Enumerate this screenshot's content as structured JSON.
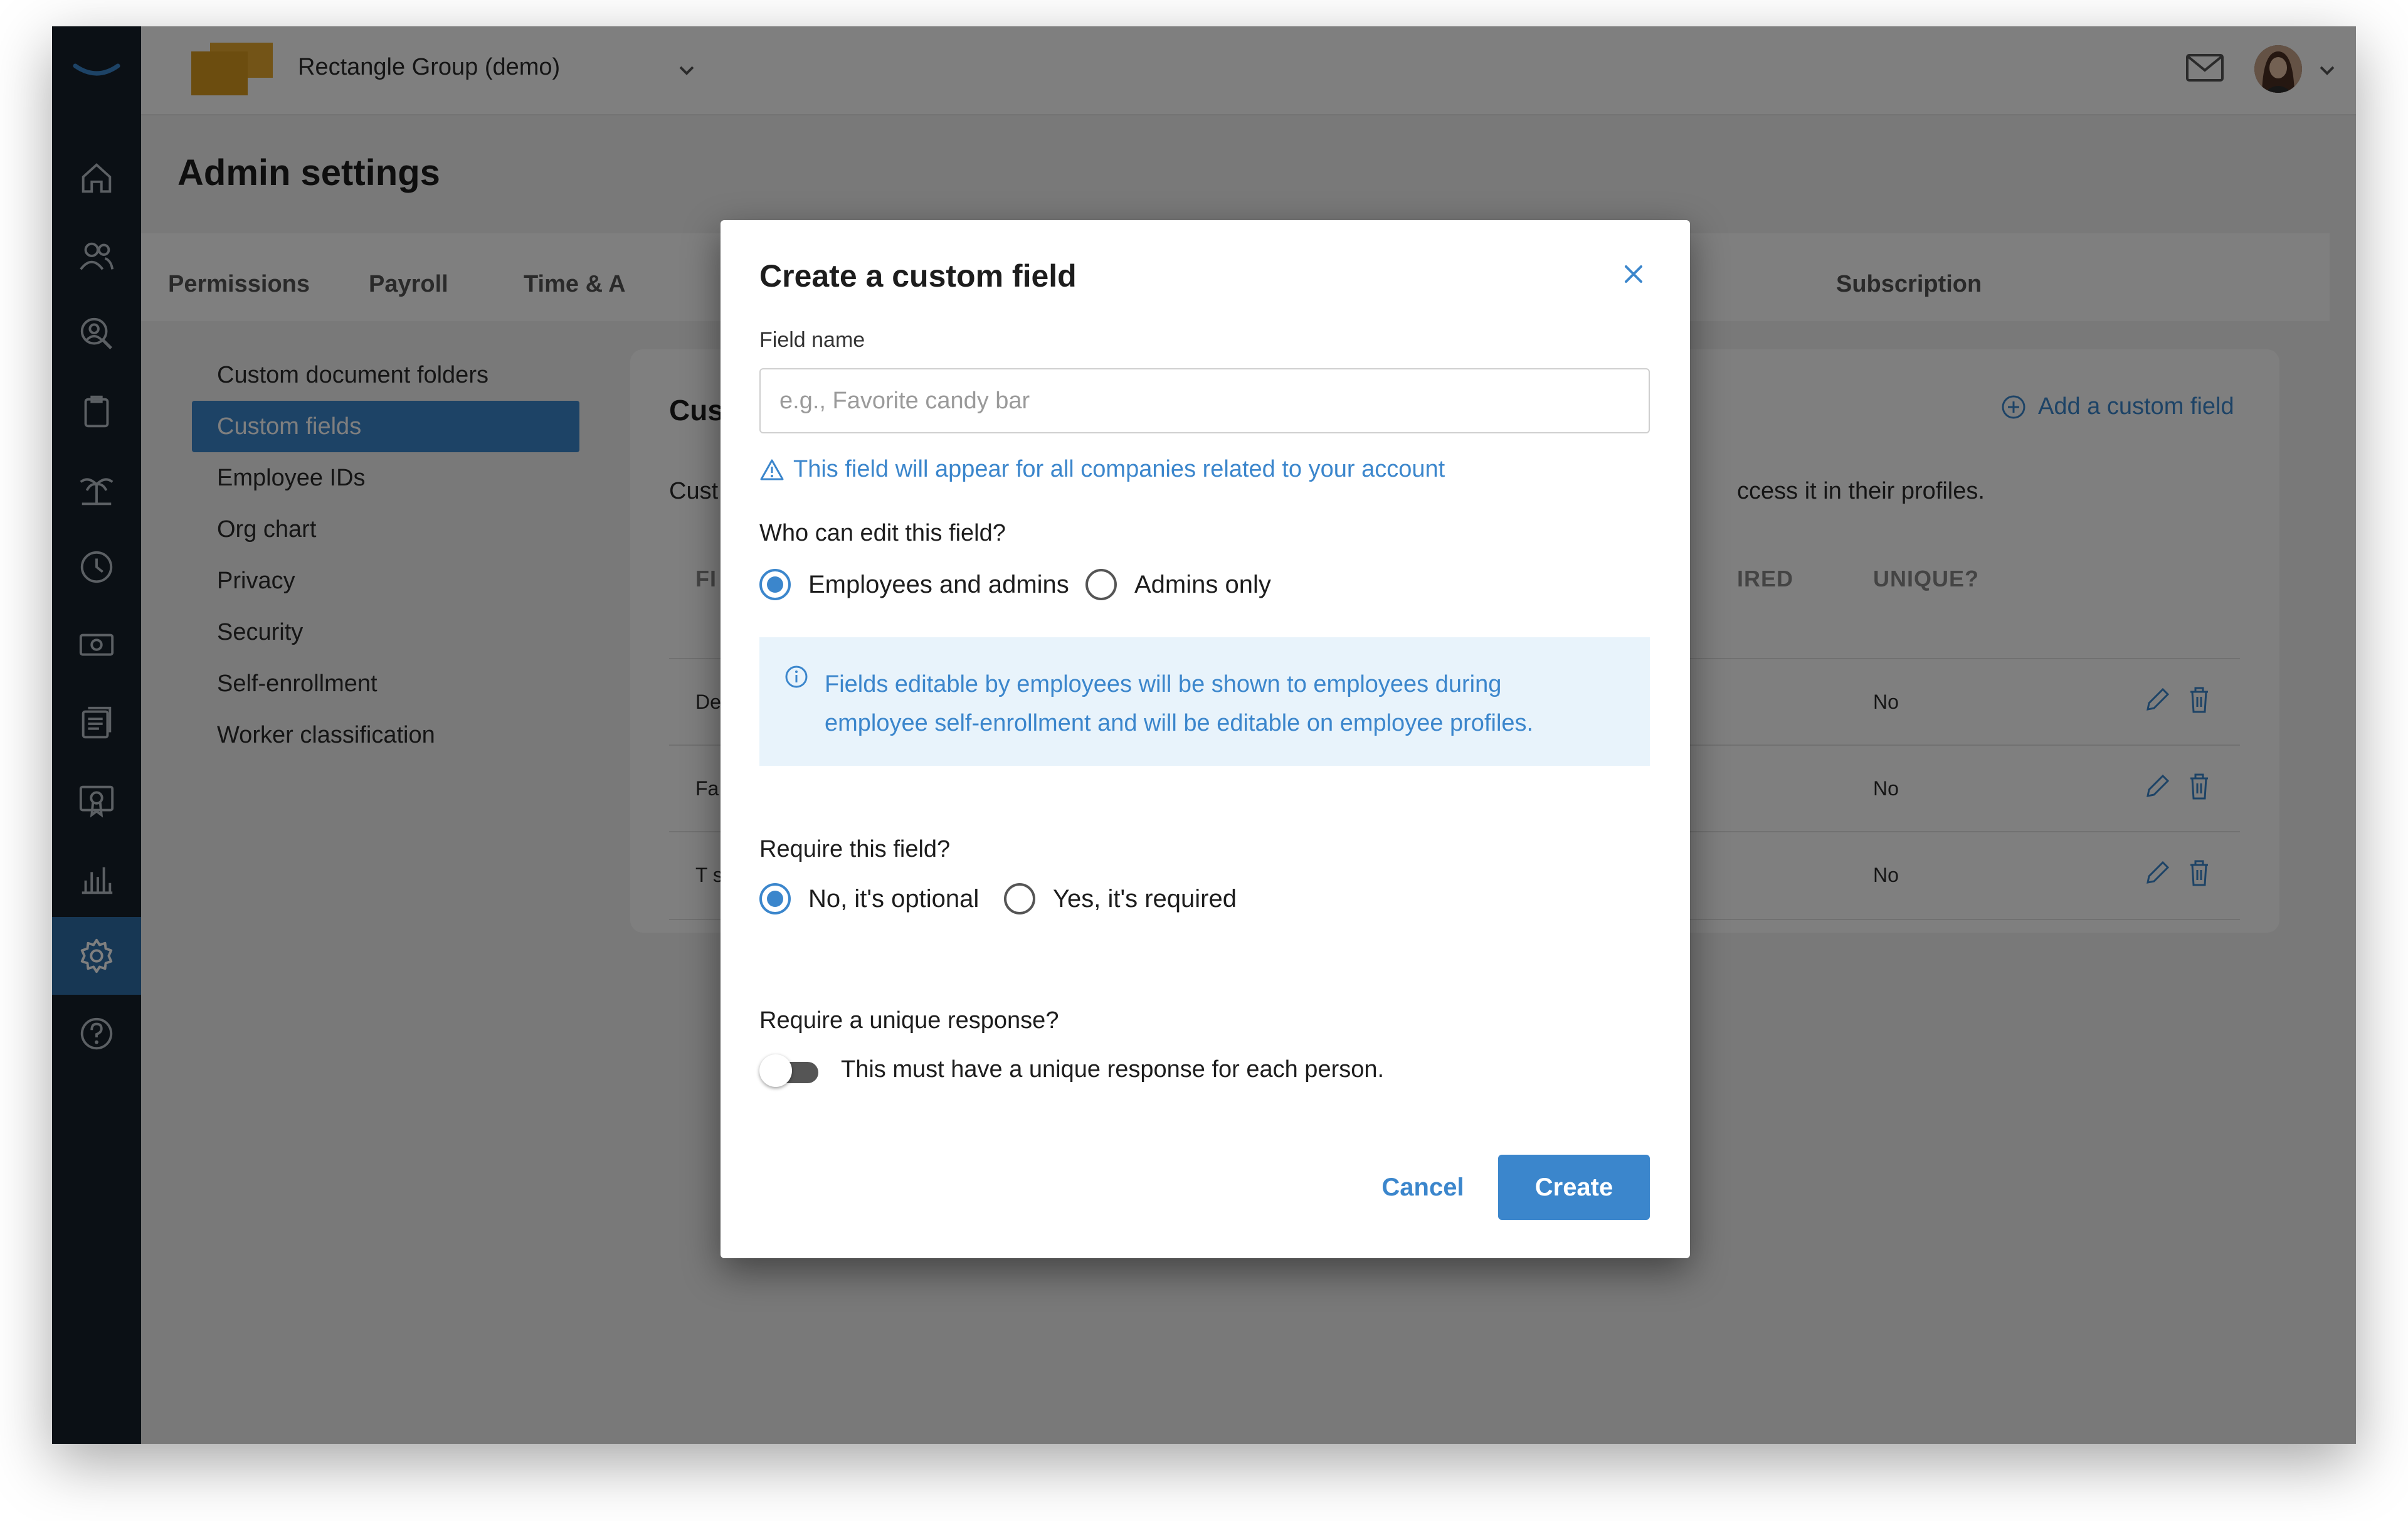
{
  "topbar": {
    "company_name": "Rectangle Group (demo)",
    "icons": [
      "smile-logo-icon",
      "company-logo",
      "chevron-down-icon",
      "mail-icon",
      "avatar",
      "chevron-down-icon"
    ]
  },
  "nav": {
    "items": [
      "home-icon",
      "people-icon",
      "profile-search-icon",
      "clipboard-icon",
      "island-icon",
      "clock-icon",
      "money-icon",
      "documents-icon",
      "certificate-icon",
      "bar-chart-icon",
      "settings-icon",
      "help-icon"
    ],
    "active": "settings-icon"
  },
  "page": {
    "title": "Admin settings",
    "tabs": [
      "Permissions",
      "Payroll",
      "Time & A",
      "Subscription"
    ]
  },
  "subnav": {
    "items": [
      {
        "label": "Custom document folders"
      },
      {
        "label": "Custom fields",
        "active": true
      },
      {
        "label": "Employee IDs"
      },
      {
        "label": "Org chart"
      },
      {
        "label": "Privacy"
      },
      {
        "label": "Security"
      },
      {
        "label": "Self-enrollment"
      },
      {
        "label": "Worker classification"
      }
    ]
  },
  "card": {
    "title_fragment": "Cus",
    "add_label": "Add a custom field",
    "desc_left_fragment": "Cust",
    "desc_right_fragment": "ccess it in their profiles.",
    "headers": {
      "field_fragment": "FI",
      "required_fragment": "IRED",
      "unique": "UNIQUE?"
    },
    "rows": [
      {
        "name_fragment": "De",
        "unique": "No"
      },
      {
        "name_fragment": "Fa",
        "unique": "No"
      },
      {
        "name_fragment": "T s",
        "unique": "No"
      }
    ]
  },
  "modal": {
    "title": "Create a custom field",
    "field_name_label": "Field name",
    "field_name_value": "",
    "field_name_placeholder": "e.g., Favorite candy bar",
    "warning": "This field will appear for all companies related to your account",
    "edit_question": "Who can edit this field?",
    "edit_options": [
      {
        "label": "Employees and admins",
        "selected": true
      },
      {
        "label": "Admins only",
        "selected": false
      }
    ],
    "info": "Fields editable by employees will be shown to employees during employee self-enrollment and will be editable on employee profiles.",
    "require_question": "Require this field?",
    "require_options": [
      {
        "label": "No, it's optional",
        "selected": true
      },
      {
        "label": "Yes, it's required",
        "selected": false
      }
    ],
    "unique_question": "Require a unique response?",
    "unique_toggle_on": false,
    "unique_toggle_label": "This must have a unique response for each person.",
    "cancel_label": "Cancel",
    "create_label": "Create"
  },
  "colors": {
    "accent": "#3b86cc",
    "nav_bg": "#17212b",
    "info_bg": "#e8f3fb",
    "overlay": "rgba(0,0,0,0.5)"
  }
}
